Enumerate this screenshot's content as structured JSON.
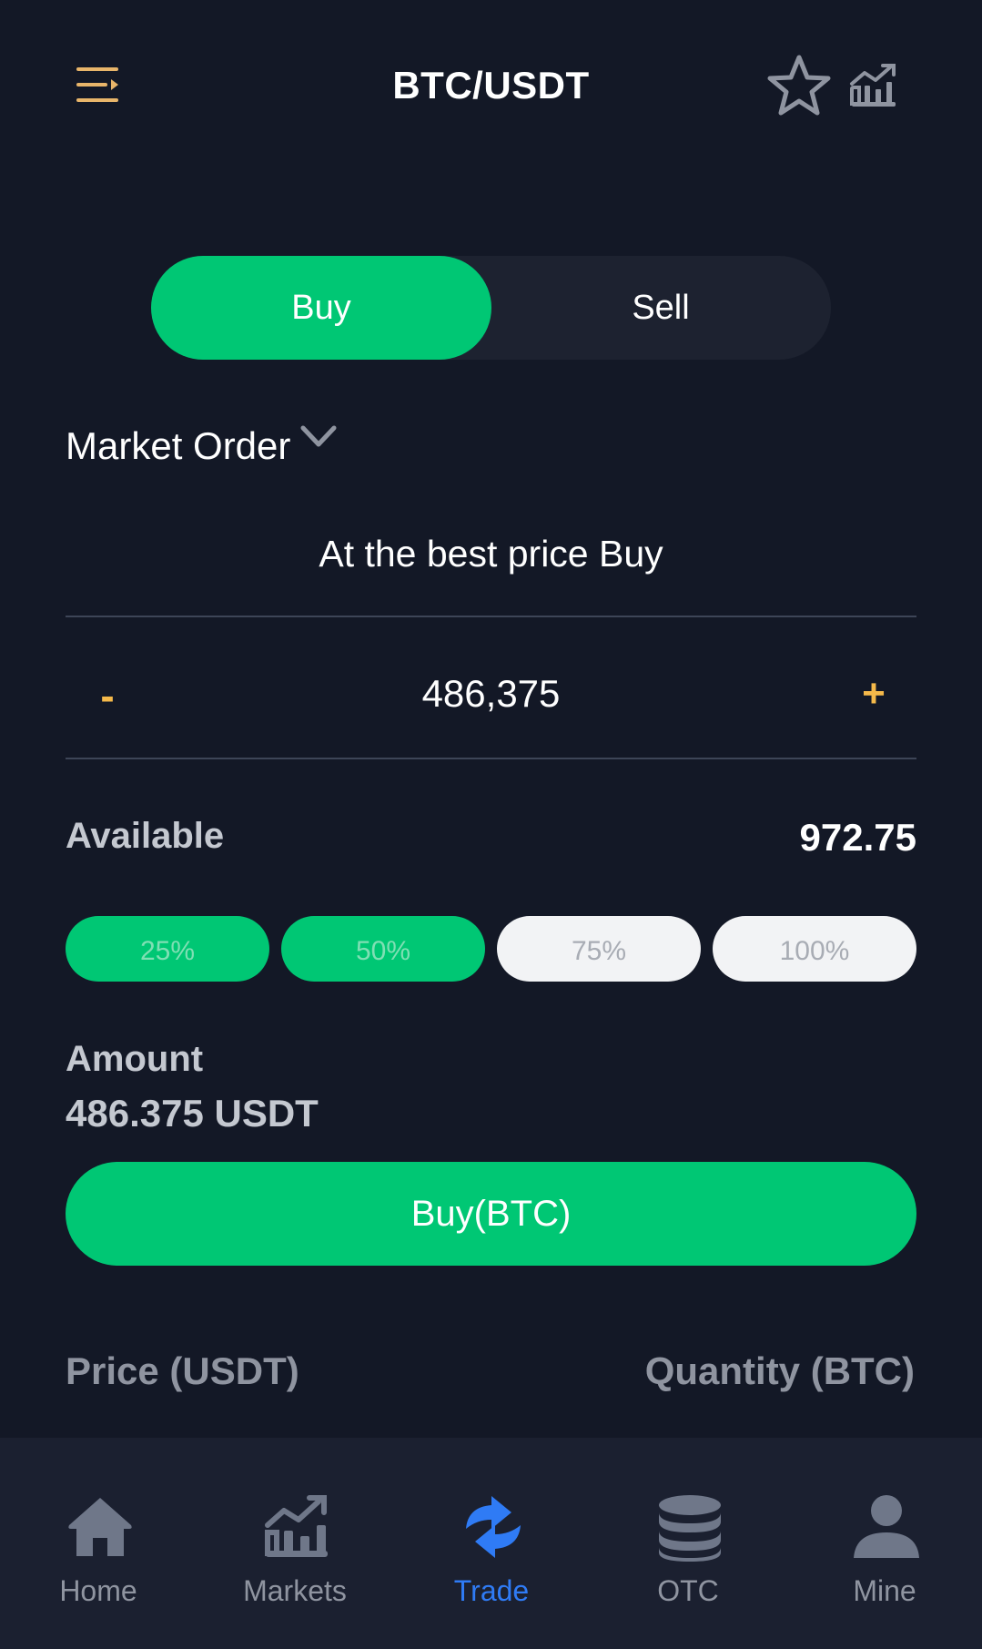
{
  "header": {
    "title": "BTC/USDT",
    "icons": {
      "menu": "menu-lines-icon",
      "favorite": "star-icon",
      "chart": "chart-icon"
    }
  },
  "toggle": {
    "buy_label": "Buy",
    "sell_label": "Sell",
    "selected": "Buy"
  },
  "order": {
    "type_label": "Market Order",
    "best_price_text": "At the best price Buy"
  },
  "stepper": {
    "minus": "-",
    "value": "486,375",
    "plus": "+"
  },
  "available": {
    "label": "Available",
    "value": "972.75"
  },
  "percent_buttons": [
    {
      "label": "25%",
      "active": true
    },
    {
      "label": "50%",
      "active": true
    },
    {
      "label": "75%",
      "active": false
    },
    {
      "label": "100%",
      "active": false
    }
  ],
  "amount": {
    "label": "Amount",
    "value": "486.375 USDT"
  },
  "buy_button": {
    "label": "Buy(BTC)"
  },
  "orderbook_header": {
    "price": "Price (USDT)",
    "quantity": "Quantity (BTC)"
  },
  "bottom_nav": [
    {
      "label": "Home",
      "icon": "home-icon",
      "active": false
    },
    {
      "label": "Markets",
      "icon": "markets-icon",
      "active": false
    },
    {
      "label": "Trade",
      "icon": "trade-icon",
      "active": true
    },
    {
      "label": "OTC",
      "icon": "coins-icon",
      "active": false
    },
    {
      "label": "Mine",
      "icon": "user-icon",
      "active": false
    }
  ],
  "colors": {
    "background": "#131826",
    "accent_green": "#00c774",
    "accent_gold": "#f5b94a",
    "active_blue": "#2f7bf5",
    "nav_background": "#1b2030"
  }
}
